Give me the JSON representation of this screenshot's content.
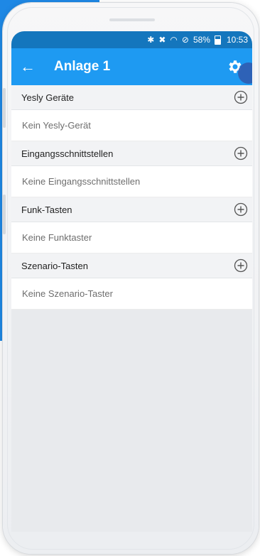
{
  "status_bar": {
    "bluetooth_icon": "bluetooth-icon",
    "mute_icon": "vibrate-off-icon",
    "wifi_icon": "wifi-icon",
    "dnd_icon": "do-not-disturb-icon",
    "battery_percent": "58%",
    "time": "10:53"
  },
  "app_bar": {
    "back_label": "←",
    "title": "Anlage 1",
    "settings_icon": "gear-icon"
  },
  "sections": [
    {
      "title": "Yesly Geräte",
      "empty_text": "Kein Yesly-Gerät"
    },
    {
      "title": "Eingangsschnittstellen",
      "empty_text": "Keine Eingangsschnittstellen"
    },
    {
      "title": "Funk-Tasten",
      "empty_text": "Keine Funktaster"
    },
    {
      "title": "Szenario-Tasten",
      "empty_text": "Keine Szenario-Taster"
    }
  ],
  "colors": {
    "status_bar": "#1476bd",
    "app_bar": "#1e9af2",
    "background": "#e8eaed",
    "section_header": "#f2f3f5"
  }
}
